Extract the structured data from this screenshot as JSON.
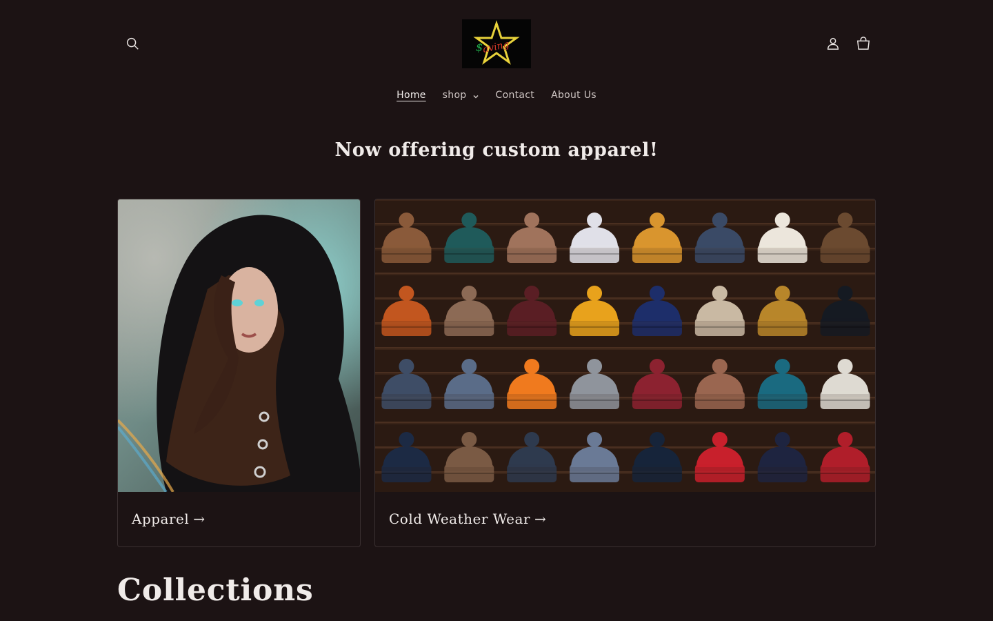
{
  "header": {
    "logo_text": "$aving",
    "nav": [
      {
        "label": "Home",
        "active": true
      },
      {
        "label": "shop",
        "has_dropdown": true
      },
      {
        "label": "Contact"
      },
      {
        "label": "About Us"
      }
    ]
  },
  "hero": {
    "headline": "Now offering custom apparel!"
  },
  "collections_cards": [
    {
      "title": "Apparel",
      "arrow": "→"
    },
    {
      "title": "Cold Weather  Wear",
      "arrow": "→"
    }
  ],
  "section": {
    "heading": "Collections"
  },
  "icons": {
    "search": "search-icon",
    "account": "user-icon",
    "cart": "cart-icon"
  },
  "colors": {
    "background": "#1c1314",
    "text": "#e9e4e2",
    "logo_star": "#e8d23a",
    "logo_text_green": "#1fa84a",
    "logo_text_red": "#d93a2a"
  }
}
